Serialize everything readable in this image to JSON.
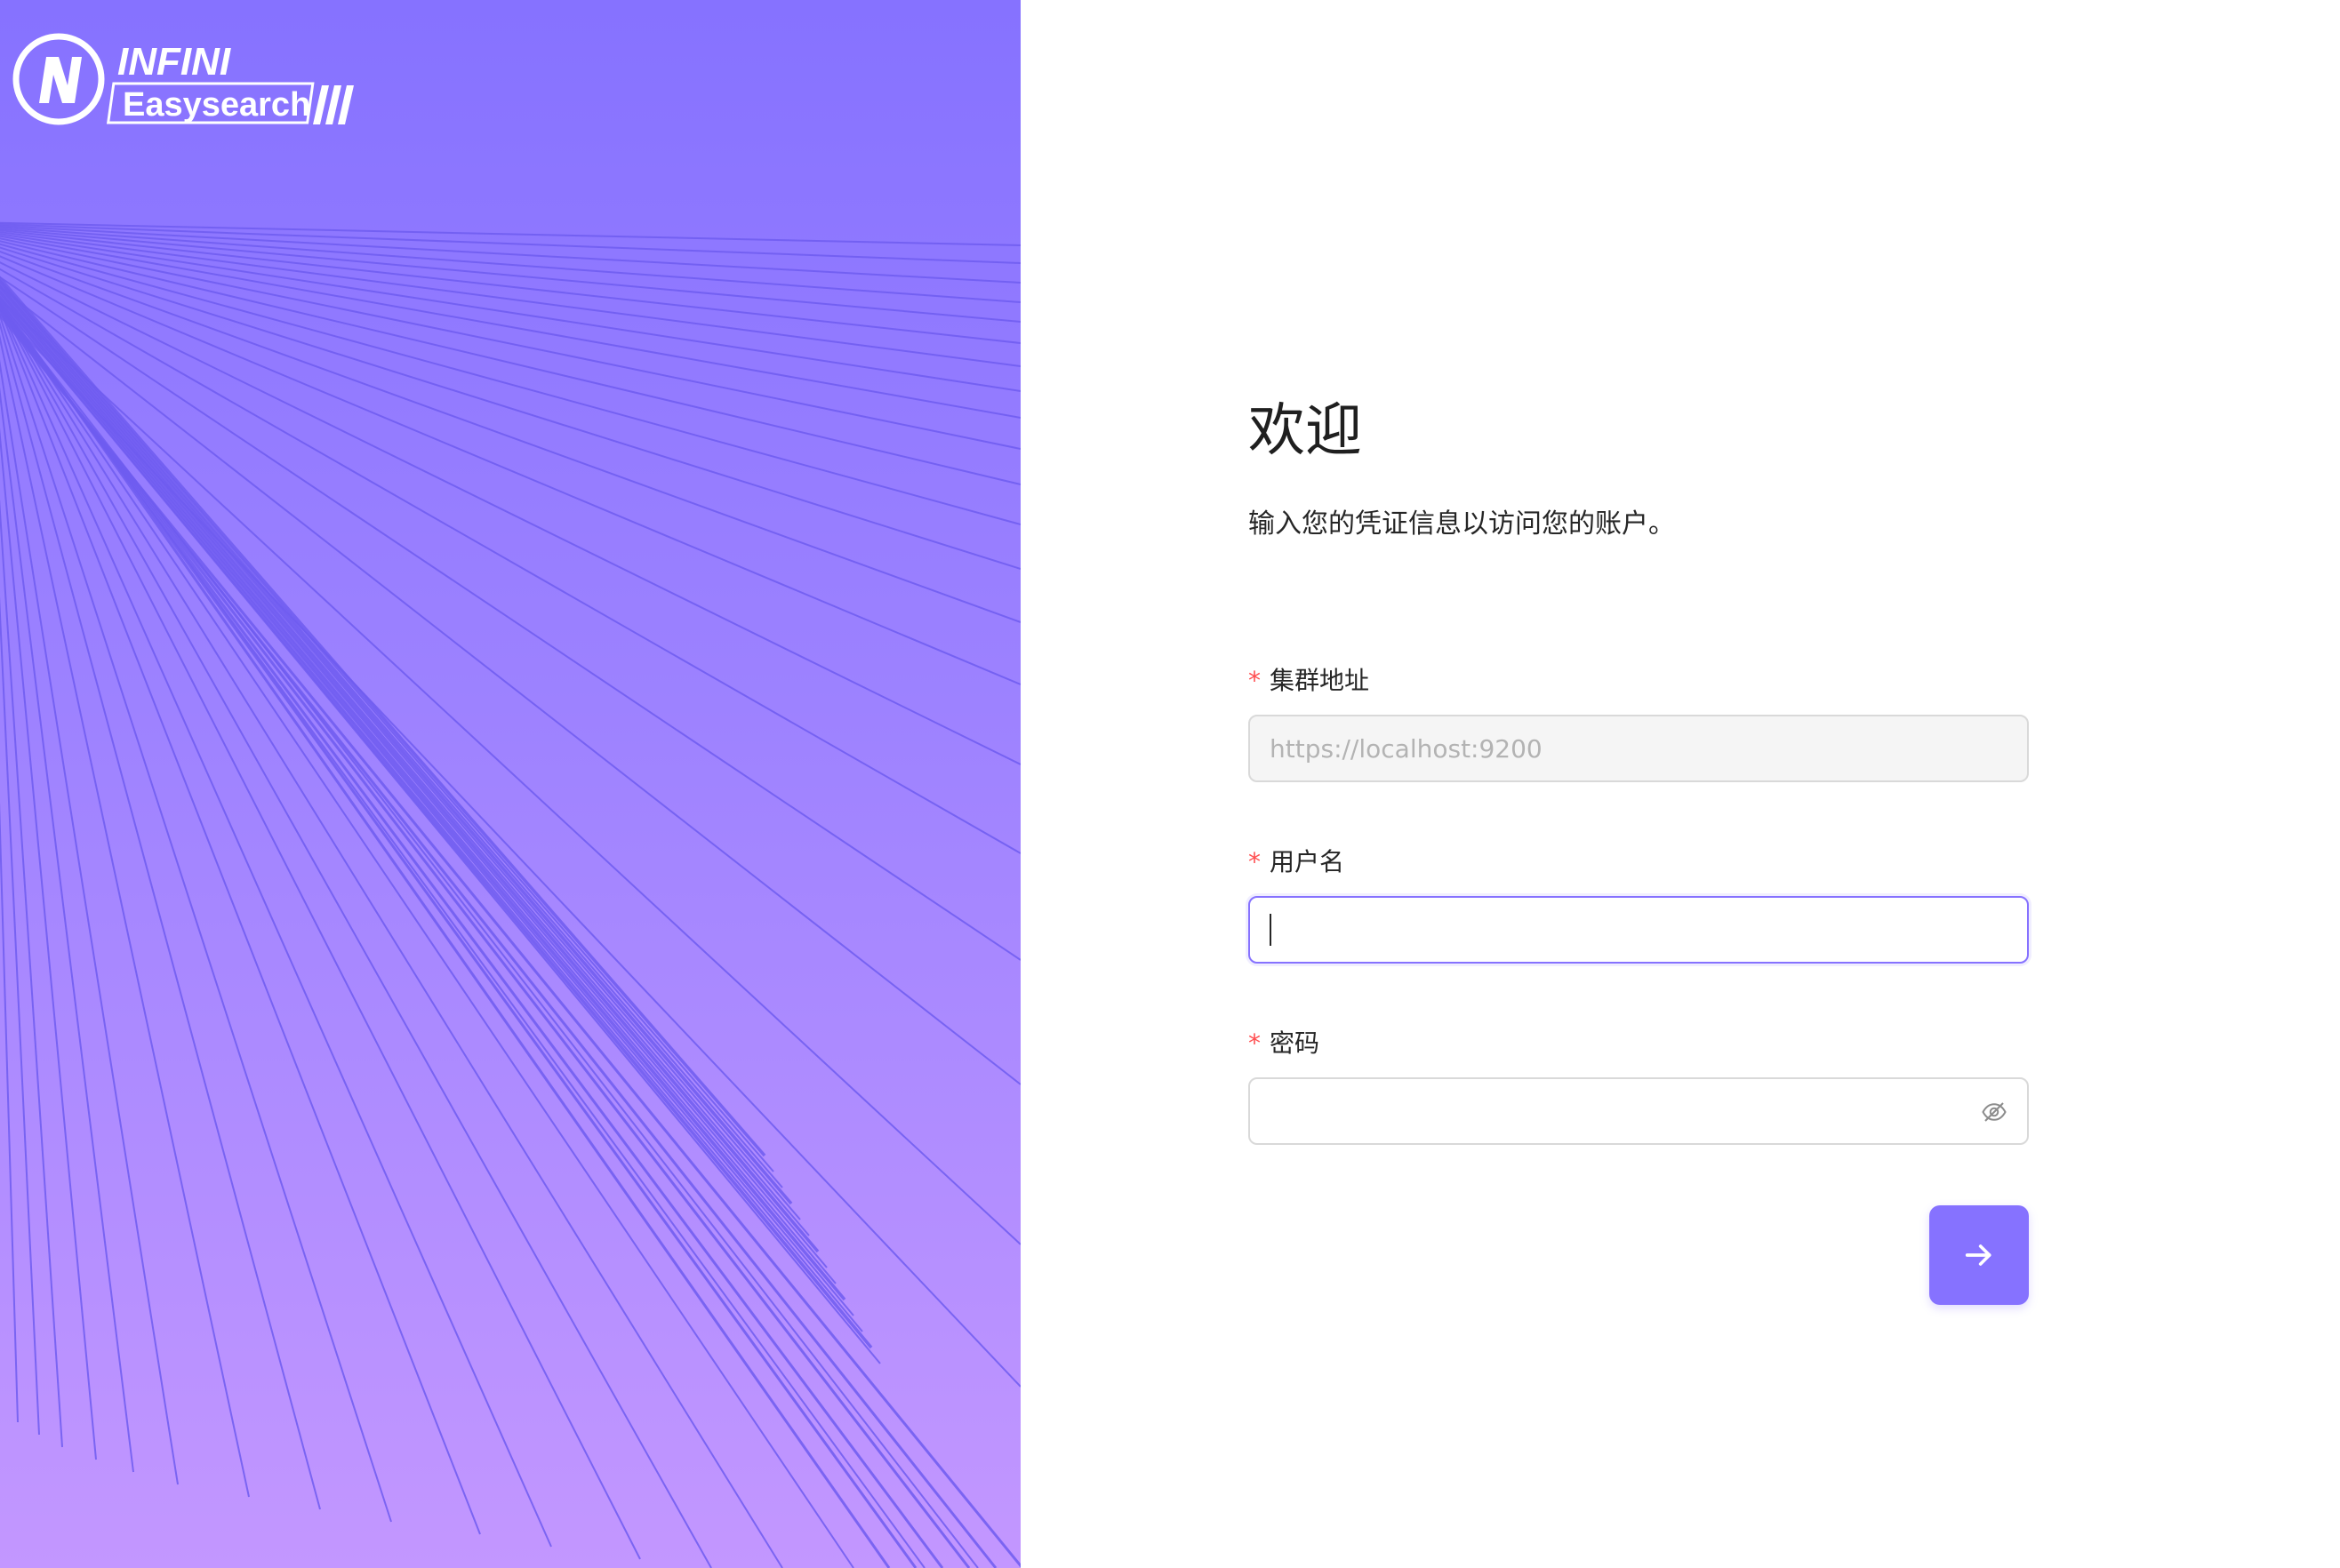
{
  "brand": {
    "line1": "INFINI",
    "line2": "Easysearch",
    "logo_icon": "infini-n-logo-icon"
  },
  "colors": {
    "accent": "#8672ff",
    "required": "#ff4d4f",
    "panel_top": "#8672ff",
    "panel_bottom": "#c397ff"
  },
  "welcome": {
    "title": "欢迎",
    "subtitle": "输入您的凭证信息以访问您的账户。"
  },
  "form": {
    "cluster": {
      "label": "集群地址",
      "placeholder": "https://localhost:9200",
      "value": "",
      "disabled": true
    },
    "username": {
      "label": "用户名",
      "value": "",
      "focused": true
    },
    "password": {
      "label": "密码",
      "value": "",
      "toggle_icon": "eye-invisible-icon"
    },
    "required_mark": "*",
    "submit_icon": "arrow-right-icon"
  }
}
